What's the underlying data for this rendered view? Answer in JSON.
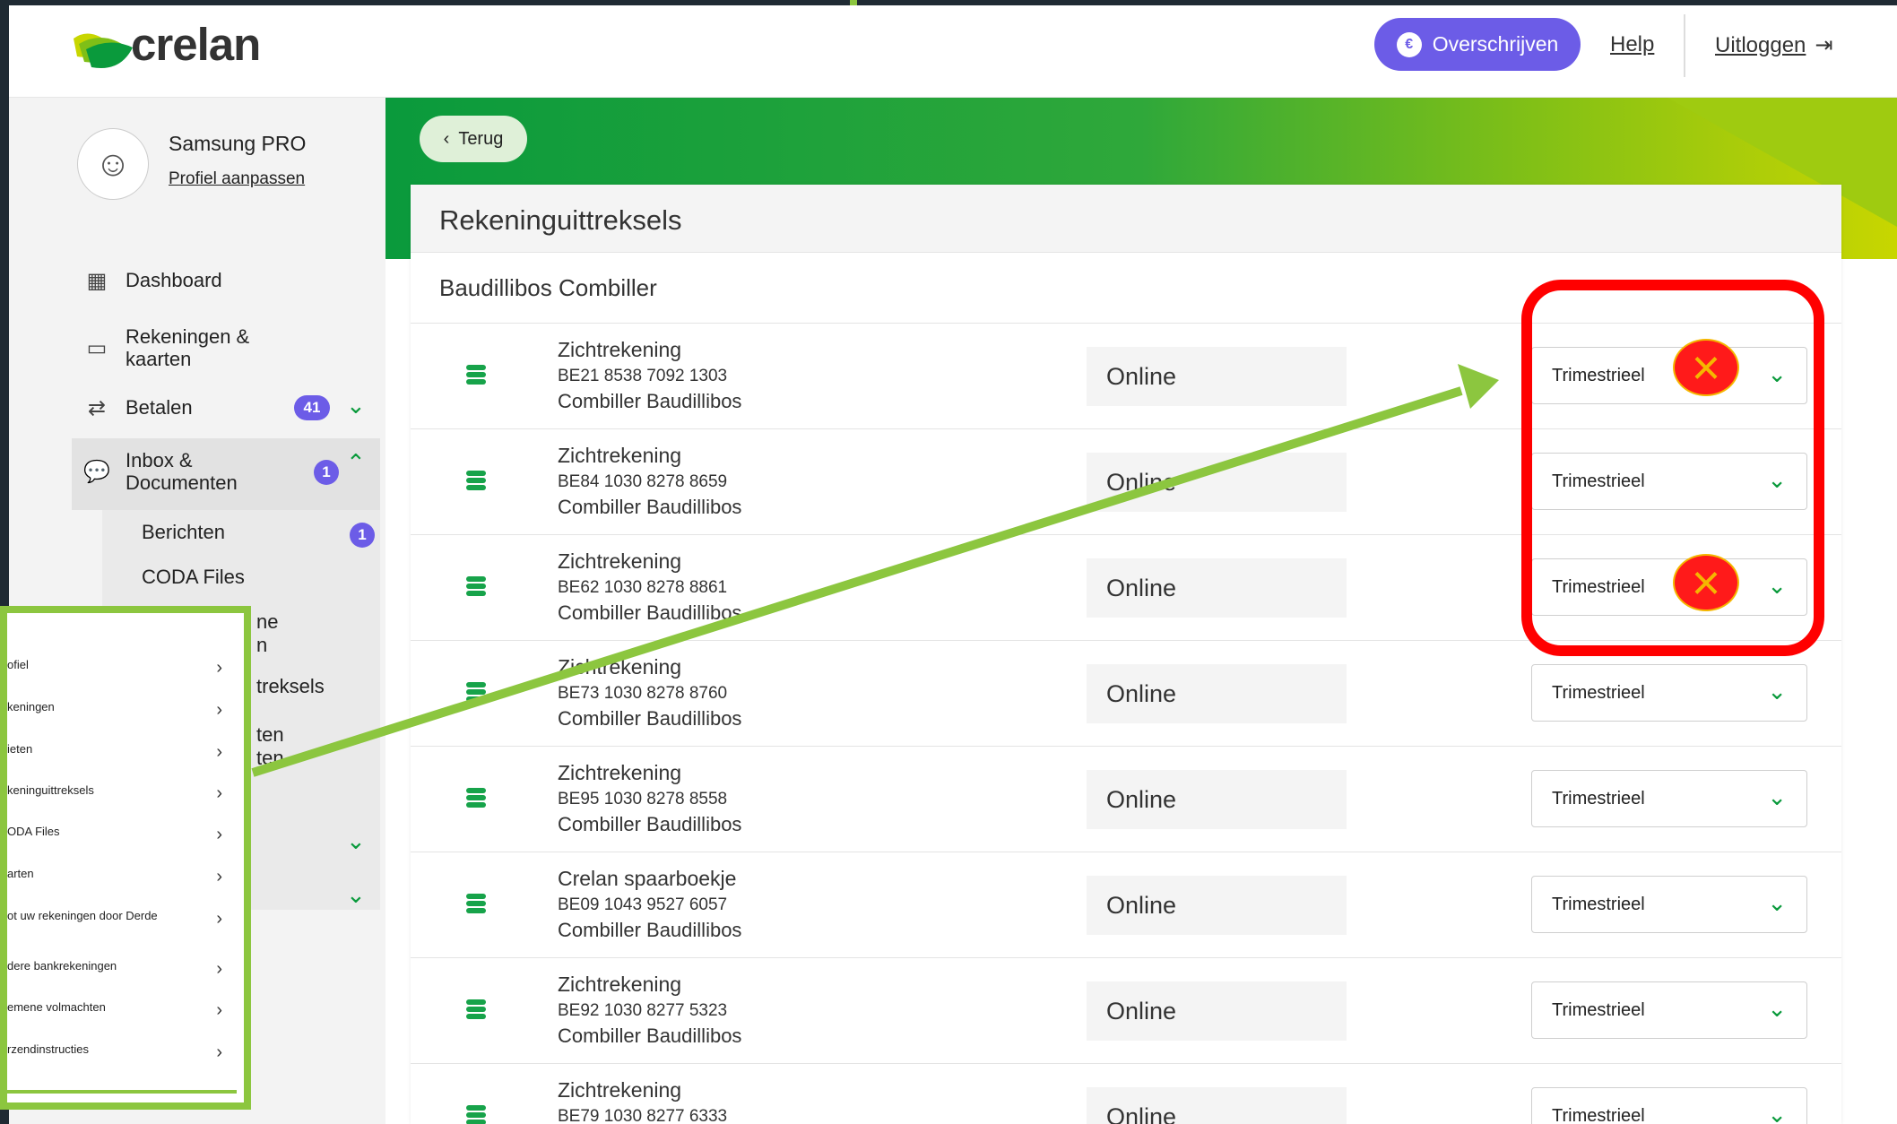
{
  "brand": {
    "logo_text": "crelan"
  },
  "header": {
    "transfer_label": "Overschrijven",
    "help_label": "Help",
    "logout_label": "Uitloggen"
  },
  "user": {
    "name": "Samsung PRO",
    "profile_link": "Profiel aanpassen"
  },
  "sidebar": {
    "items": [
      {
        "label": "Dashboard",
        "icon": "grid-icon"
      },
      {
        "label_line1": "Rekeningen &",
        "label_line2": "kaarten",
        "icon": "card-icon"
      },
      {
        "label": "Betalen",
        "icon": "transfer-icon",
        "badge": "41"
      },
      {
        "label_line1": "Inbox &",
        "label_line2": "Documenten",
        "icon": "chat-icon",
        "badge": "1"
      }
    ],
    "sub_items": [
      {
        "label": "Berichten",
        "badge": "1"
      },
      {
        "label": "CODA Files"
      },
      {
        "label": "ne"
      },
      {
        "label": "n"
      },
      {
        "label": "treksels"
      },
      {
        "label": "ten"
      },
      {
        "label": "ten"
      }
    ]
  },
  "page": {
    "back_label": "Terug",
    "title": "Rekeninguittreksels",
    "subtitle": "Baudillibos Combiller"
  },
  "accounts": [
    {
      "type": "Zichtrekening",
      "iban": "BE21 8538 7092 1303",
      "holder": "Combiller Baudillibos",
      "status": "Online",
      "frequency": "Trimestrieel"
    },
    {
      "type": "Zichtrekening",
      "iban": "BE84 1030 8278 8659",
      "holder": "Combiller Baudillibos",
      "status": "Online",
      "frequency": "Trimestrieel"
    },
    {
      "type": "Zichtrekening",
      "iban": "BE62 1030 8278 8861",
      "holder": "Combiller Baudillibos",
      "status": "Online",
      "frequency": "Trimestrieel"
    },
    {
      "type": "Zichtrekening",
      "iban": "BE73 1030 8278 8760",
      "holder": "Combiller Baudillibos",
      "status": "Online",
      "frequency": "Trimestrieel"
    },
    {
      "type": "Zichtrekening",
      "iban": "BE95 1030 8278 8558",
      "holder": "Combiller Baudillibos",
      "status": "Online",
      "frequency": "Trimestrieel"
    },
    {
      "type": "Crelan spaarboekje",
      "iban": "BE09 1043 9527 6057",
      "holder": "Combiller Baudillibos",
      "status": "Online",
      "frequency": "Trimestrieel"
    },
    {
      "type": "Zichtrekening",
      "iban": "BE92 1030 8277 5323",
      "holder": "Combiller Baudillibos",
      "status": "Online",
      "frequency": "Trimestrieel"
    },
    {
      "type": "Zichtrekening",
      "iban": "BE79 1030 8277 6333",
      "holder": "",
      "status": "Online",
      "frequency": "Trimestrieel"
    }
  ],
  "popup_menu": [
    "ofiel",
    "keningen",
    "ieten",
    "keninguittreksels",
    "ODA Files",
    "arten",
    "ot uw rekeningen door Derde",
    "dere bankrekeningen",
    "emene volmachten",
    "rzendinstructies"
  ],
  "colors": {
    "accent": "#6c5ce7",
    "brand_green": "#0a9a3c",
    "annotation_red": "#ff0000",
    "annotation_green": "#8cc63f"
  }
}
